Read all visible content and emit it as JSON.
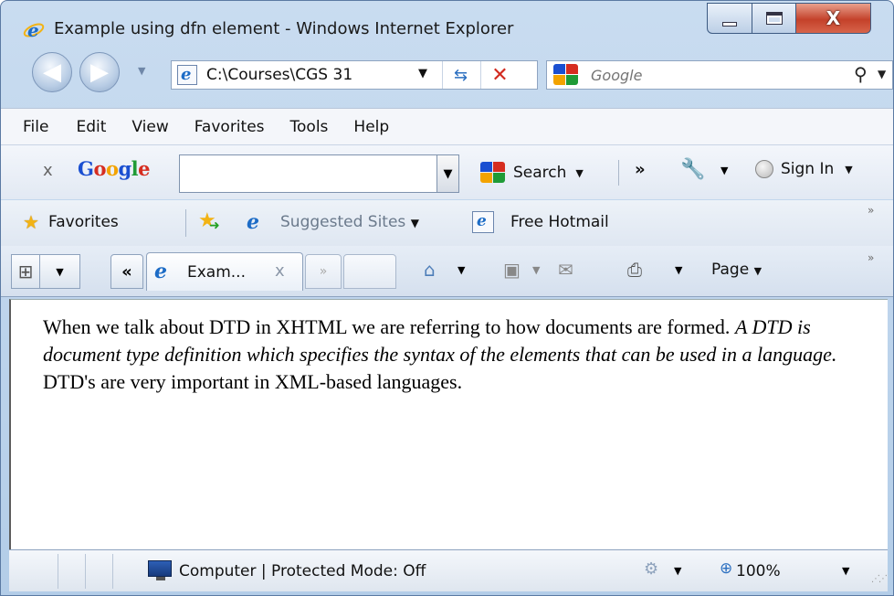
{
  "window": {
    "title": "Example using dfn element - Windows Internet Explorer",
    "close_glyph": "X"
  },
  "navigation": {
    "address_value": "C:\\Courses\\CGS 31",
    "search_placeholder": "Google",
    "back_glyph": "◀",
    "forward_glyph": "▶"
  },
  "menu": {
    "items": [
      "File",
      "Edit",
      "View",
      "Favorites",
      "Tools",
      "Help"
    ]
  },
  "google_toolbar": {
    "close_glyph": "x",
    "logo": [
      "G",
      "o",
      "o",
      "g",
      "l",
      "e"
    ],
    "logo_colors": [
      "#1a4fd1",
      "#d62d20",
      "#f3a300",
      "#1a4fd1",
      "#1f9b36",
      "#d62d20"
    ],
    "search_label": "Search",
    "more_glyph": "»",
    "signin_label": "Sign In"
  },
  "favorites_bar": {
    "favorites_label": "Favorites",
    "suggested_label": "Suggested Sites",
    "hotmail_label": "Free Hotmail",
    "more_glyph": "»"
  },
  "tabs": {
    "active_label": "Exam...",
    "close_glyph": "x",
    "scroll_left_glyph": "«",
    "scroll_right_glyph": "»",
    "quicktabs_glyph": "⊞",
    "page_menu_label": "Page",
    "more_glyph": "»"
  },
  "content": {
    "text_before": "When we talk about DTD in XHTML we are referring to how documents are formed. ",
    "definition": "A DTD is document type definition which specifies the syntax of the elements that can be used in a language.",
    "text_after": " DTD's are very important in XML-based languages."
  },
  "status_bar": {
    "zone_text": "Computer | Protected Mode: Off",
    "zoom_text": "100%"
  },
  "colors": {
    "ie_blue": "#1d6cc6",
    "close_red": "#c4412a",
    "stop_red": "#d22a1f",
    "favorites_gold": "#f2b315"
  }
}
